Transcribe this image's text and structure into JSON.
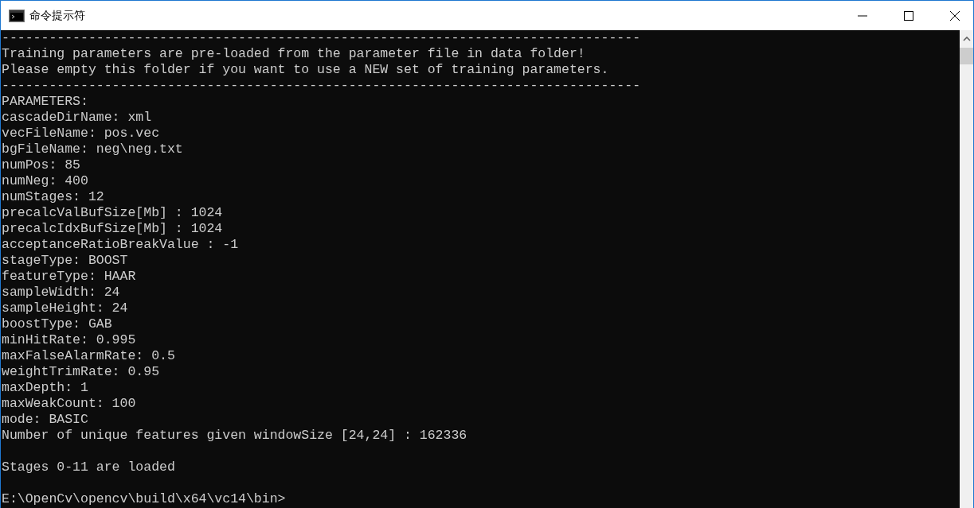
{
  "window": {
    "title": "命令提示符"
  },
  "console": {
    "lines": [
      {
        "kind": "text",
        "text": "---------------------------------------------------------------------------------"
      },
      {
        "kind": "text",
        "text": "Training parameters are pre-loaded from the parameter file in data folder!"
      },
      {
        "kind": "text",
        "text": "Please empty this folder if you want to use a NEW set of training parameters."
      },
      {
        "kind": "text",
        "text": "---------------------------------------------------------------------------------"
      },
      {
        "kind": "text",
        "text": "PARAMETERS:"
      },
      {
        "kind": "text",
        "text": "cascadeDirName: xml"
      },
      {
        "kind": "text",
        "text": "vecFileName: pos.vec"
      },
      {
        "kind": "text",
        "text": "bgFileName: neg\\neg.txt"
      },
      {
        "kind": "text",
        "text": "numPos: 85"
      },
      {
        "kind": "text",
        "text": "numNeg: 400"
      },
      {
        "kind": "text",
        "text": "numStages: 12"
      },
      {
        "kind": "text",
        "text": "precalcValBufSize[Mb] : 1024"
      },
      {
        "kind": "text",
        "text": "precalcIdxBufSize[Mb] : 1024"
      },
      {
        "kind": "text",
        "text": "acceptanceRatioBreakValue : -1"
      },
      {
        "kind": "text",
        "text": "stageType: BOOST"
      },
      {
        "kind": "text",
        "text": "featureType: HAAR"
      },
      {
        "kind": "text",
        "text": "sampleWidth: 24"
      },
      {
        "kind": "text",
        "text": "sampleHeight: 24"
      },
      {
        "kind": "text",
        "text": "boostType: GAB"
      },
      {
        "kind": "text",
        "text": "minHitRate: 0.995"
      },
      {
        "kind": "text",
        "text": "maxFalseAlarmRate: 0.5"
      },
      {
        "kind": "text",
        "text": "weightTrimRate: 0.95"
      },
      {
        "kind": "text",
        "text": "maxDepth: 1"
      },
      {
        "kind": "text",
        "text": "maxWeakCount: 100"
      },
      {
        "kind": "text",
        "text": "mode: BASIC"
      },
      {
        "kind": "text",
        "text": "Number of unique features given windowSize [24,24] : 162336"
      },
      {
        "kind": "blank"
      },
      {
        "kind": "text",
        "text": "Stages 0-11 are loaded"
      },
      {
        "kind": "blank"
      },
      {
        "kind": "text",
        "text": "E:\\OpenCv\\opencv\\build\\x64\\vc14\\bin>"
      }
    ]
  }
}
